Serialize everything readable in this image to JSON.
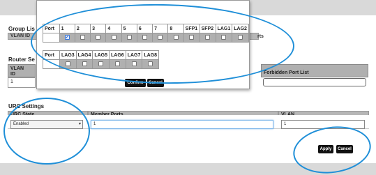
{
  "group_list": {
    "title": "Group Lis",
    "col_vlan_id": "VLAN ID",
    "col_ports_fragment": "rts"
  },
  "router": {
    "title": "Router Se",
    "col_vlan_id": "VLAN\nID",
    "col_forbidden": "Forbidden Port List",
    "row_vlan_id": "1"
  },
  "urc": {
    "title": "URC Settings",
    "col_state": "URC State",
    "col_member_ports": "Member Ports",
    "col_vlan": "VLAN",
    "state_value": "Enabled",
    "member_ports_value": "1",
    "vlan_value": "1"
  },
  "buttons": {
    "apply": "Apply",
    "cancel": "Cancel"
  },
  "popup": {
    "row1_header": [
      "Port",
      "1",
      "2",
      "3",
      "4",
      "5",
      "6",
      "7",
      "8",
      "SFP1",
      "SFP2",
      "LAG1",
      "LAG2"
    ],
    "row1_checked": [
      true,
      false,
      false,
      false,
      false,
      false,
      false,
      false,
      false,
      false,
      false,
      false
    ],
    "row2_header": [
      "Port",
      "LAG3",
      "LAG4",
      "LAG5",
      "LAG6",
      "LAG7",
      "LAG8"
    ],
    "row2_checked": [
      false,
      false,
      false,
      false,
      false,
      false
    ],
    "confirm": "Confirm",
    "cancel": "Cancel"
  },
  "colors": {
    "annotation_blue": "#1f8fd8",
    "annotation_red": "#e02a2a",
    "header_gray": "#b7b7b7"
  }
}
